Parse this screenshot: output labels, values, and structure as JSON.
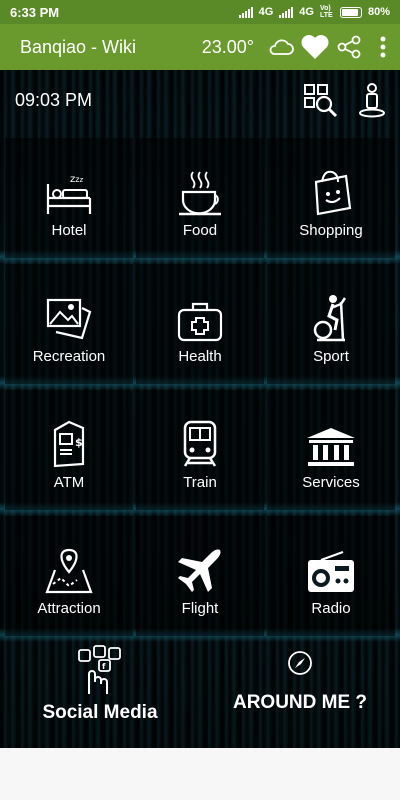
{
  "status_bar": {
    "time": "6:33 PM",
    "network_1": "4G",
    "network_2": "4G",
    "lte": "Vo) LTE",
    "battery": "80%"
  },
  "app_bar": {
    "title": "Banqiao - Wiki",
    "temperature": "23.00°",
    "icons": [
      "cloud-icon",
      "heart-icon",
      "share-icon",
      "more-vert-icon"
    ]
  },
  "clock": "09:03 PM",
  "tiles": [
    {
      "label": "Hotel",
      "icon": "hotel-bed-icon"
    },
    {
      "label": "Food",
      "icon": "coffee-cup-icon"
    },
    {
      "label": "Shopping",
      "icon": "shopping-bag-icon"
    },
    {
      "label": "Recreation",
      "icon": "pictures-icon"
    },
    {
      "label": "Health",
      "icon": "medical-kit-icon"
    },
    {
      "label": "Sport",
      "icon": "exercise-bike-icon"
    },
    {
      "label": "ATM",
      "icon": "atm-icon"
    },
    {
      "label": "Train",
      "icon": "train-icon"
    },
    {
      "label": "Services",
      "icon": "bank-building-icon"
    },
    {
      "label": "Attraction",
      "icon": "map-pin-icon"
    },
    {
      "label": "Flight",
      "icon": "airplane-icon"
    },
    {
      "label": "Radio",
      "icon": "radio-icon"
    }
  ],
  "bottom": {
    "social": "Social Media",
    "around": "AROUND ME ?"
  },
  "colors": {
    "status_bar": "#5a8a28",
    "app_bar": "#6a9a2e",
    "tile_bg": "#000000",
    "text": "#ffffff"
  }
}
